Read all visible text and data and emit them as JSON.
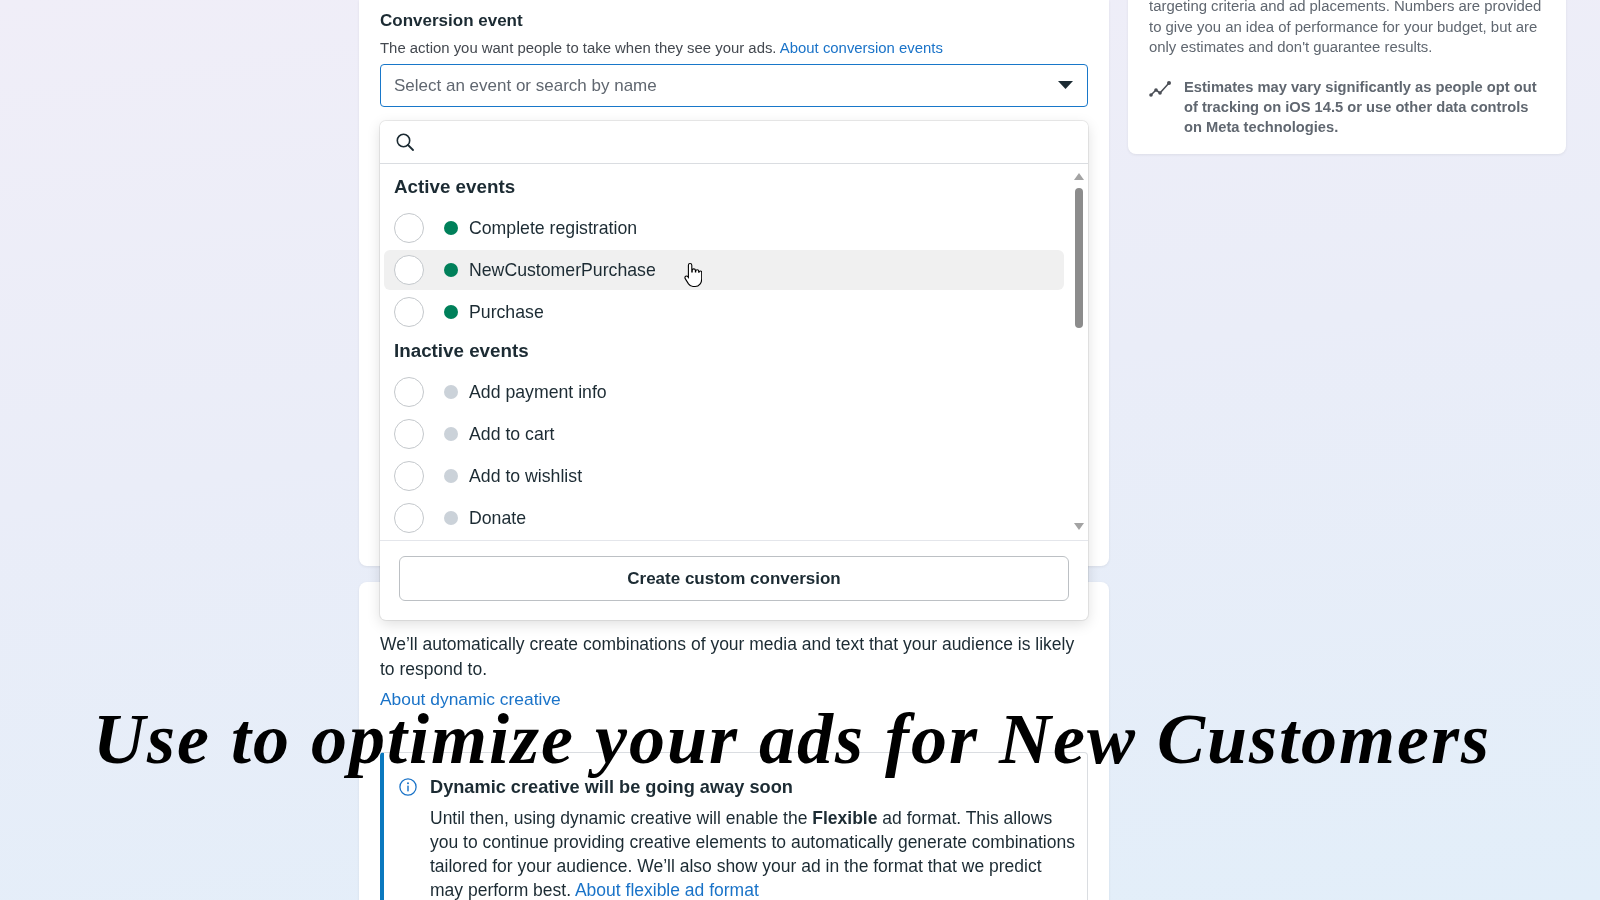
{
  "conversion_event": {
    "title": "Conversion event",
    "description": "The action you want people to take when they see your ads.",
    "description_link": "About conversion events",
    "select": {
      "placeholder": "Select an event or search by name",
      "expanded": true,
      "menu": {
        "groups": [
          {
            "title": "Active events",
            "active": true,
            "items": [
              {
                "label": "Complete registration",
                "selected": false,
                "highlighted": false
              },
              {
                "label": "NewCustomerPurchase",
                "selected": false,
                "highlighted": true
              },
              {
                "label": "Purchase",
                "selected": false,
                "highlighted": false
              }
            ]
          },
          {
            "title": "Inactive events",
            "active": false,
            "items": [
              {
                "label": "Add payment info",
                "selected": false,
                "highlighted": false
              },
              {
                "label": "Add to cart",
                "selected": false,
                "highlighted": false
              },
              {
                "label": "Add to wishlist",
                "selected": false,
                "highlighted": false
              },
              {
                "label": "Donate",
                "selected": false,
                "highlighted": false
              }
            ]
          }
        ],
        "footer_button": "Create custom conversion"
      }
    }
  },
  "estimates_panel": {
    "text": "targeting criteria and ad placements. Numbers are provided to give you an idea of performance for your budget, but are only estimates and don't guarantee results.",
    "note": "Estimates may vary significantly as people opt out of tracking on iOS 14.5 or use other data controls on Meta technologies."
  },
  "dynamic_creative": {
    "description": "We’ll automatically create combinations of your media and text that your audience is likely to respond to.",
    "link": "About dynamic creative",
    "notice": {
      "title": "Dynamic creative will be going away soon",
      "body": "Until then, using dynamic creative will enable the **Flexible** ad format. This allows you to continue providing creative elements to automatically generate combinations tailored for your audience. We’ll also show your ad in the format that we predict may perform best.",
      "link": "About flexible ad format"
    }
  },
  "caption": "Use to optimize your ads for New Customers"
}
